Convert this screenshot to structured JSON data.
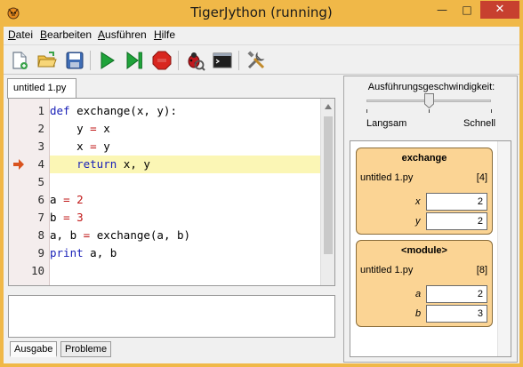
{
  "window": {
    "title": "TigerJython (running)",
    "minimize_glyph": "—",
    "maximize_glyph": "□",
    "close_glyph": "✕"
  },
  "menu": {
    "datei": {
      "first": "D",
      "rest": "atei"
    },
    "bearbeiten": {
      "first": "B",
      "rest": "earbeiten"
    },
    "ausfuehren": {
      "first": "A",
      "rest": "usführen"
    },
    "hilfe": {
      "first": "H",
      "rest": "ilfe"
    }
  },
  "toolbar": {
    "icons": [
      "new-file-icon",
      "open-folder-icon",
      "save-icon",
      "run-icon",
      "step-icon",
      "stop-icon",
      "debug-icon",
      "console-icon",
      "tools-icon"
    ]
  },
  "editor": {
    "tab_label": "untitled 1.py",
    "current_line": 4,
    "lines": [
      {
        "num": "1",
        "segments": [
          [
            "kw",
            "def"
          ],
          [
            "",
            " exchange(x, y):"
          ]
        ]
      },
      {
        "num": "2",
        "segments": [
          [
            "",
            "    y "
          ],
          [
            "op",
            "="
          ],
          [
            "",
            " x"
          ]
        ]
      },
      {
        "num": "3",
        "segments": [
          [
            "",
            "    x "
          ],
          [
            "op",
            "="
          ],
          [
            "",
            " y"
          ]
        ]
      },
      {
        "num": "4",
        "segments": [
          [
            "",
            "    "
          ],
          [
            "kw",
            "return"
          ],
          [
            "",
            " x, y"
          ]
        ]
      },
      {
        "num": "5",
        "segments": [
          [
            "",
            ""
          ]
        ]
      },
      {
        "num": "6",
        "segments": [
          [
            "",
            "a "
          ],
          [
            "op",
            "="
          ],
          [
            "",
            " "
          ],
          [
            "num",
            "2"
          ]
        ]
      },
      {
        "num": "7",
        "segments": [
          [
            "",
            "b "
          ],
          [
            "op",
            "="
          ],
          [
            "",
            " "
          ],
          [
            "num",
            "3"
          ]
        ]
      },
      {
        "num": "8",
        "segments": [
          [
            "",
            "a, b "
          ],
          [
            "op",
            "="
          ],
          [
            "",
            " exchange(a, b)"
          ]
        ]
      },
      {
        "num": "9",
        "segments": [
          [
            "kw",
            "print"
          ],
          [
            "",
            " a, b"
          ]
        ]
      },
      {
        "num": "10",
        "segments": [
          [
            "",
            ""
          ]
        ]
      }
    ],
    "colors": {
      "keyword": "#1a21b8",
      "number": "#c01818",
      "current_line": "#fbf6b5",
      "arrow": "#d9531e"
    }
  },
  "output_tabs": {
    "ausgabe": "Ausgabe",
    "probleme": "Probleme"
  },
  "debugger": {
    "speed_label": "Ausführungsgeschwindigkeit:",
    "slow_label": "Langsam",
    "fast_label": "Schnell",
    "speed_level": 0.5,
    "frames": [
      {
        "title": "exchange",
        "file": "untitled 1.py",
        "line": "[4]",
        "vars": [
          {
            "name": "x",
            "value": "2"
          },
          {
            "name": "y",
            "value": "2"
          }
        ]
      },
      {
        "title": "<module>",
        "file": "untitled 1.py",
        "line": "[8]",
        "vars": [
          {
            "name": "a",
            "value": "2"
          },
          {
            "name": "b",
            "value": "3"
          }
        ]
      }
    ],
    "frame_color": "#fbd494"
  }
}
